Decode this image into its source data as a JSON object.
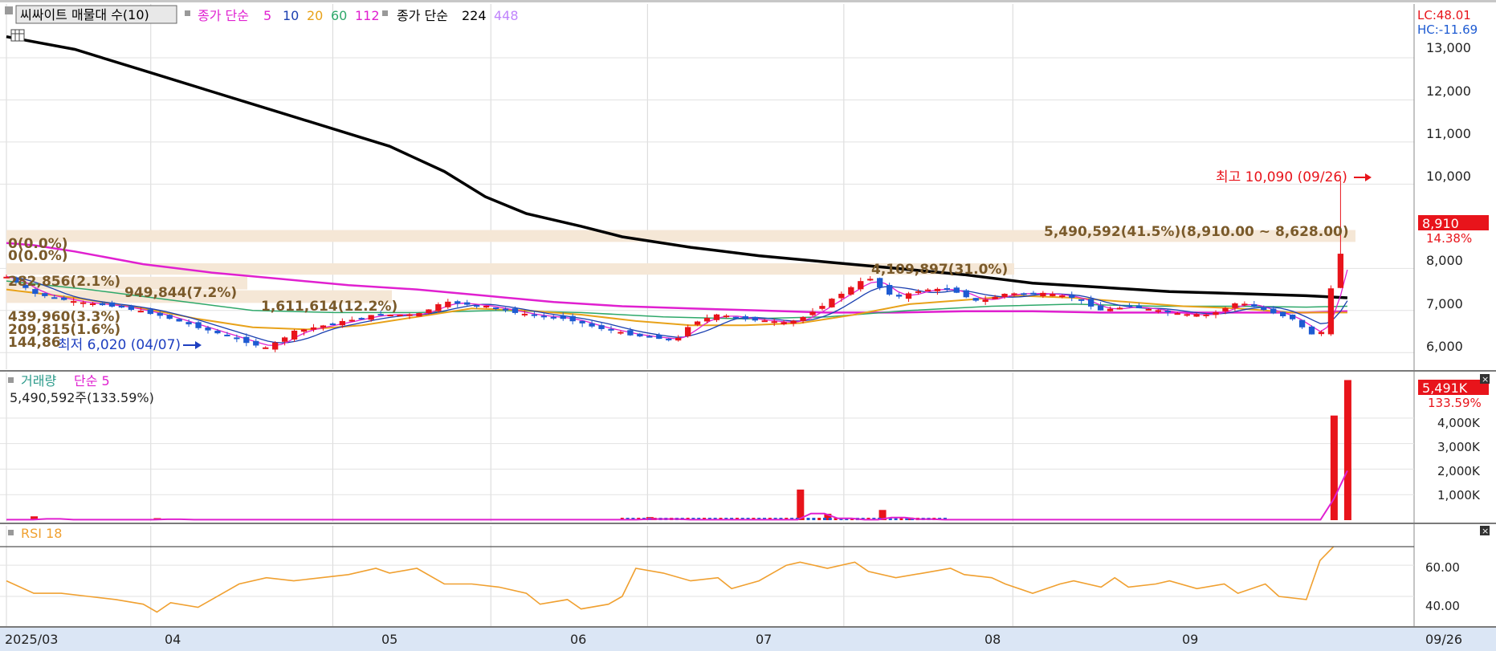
{
  "header": {
    "indicator_label": "씨싸이트 매물대 수(10)",
    "ma_label": "종가 단순",
    "ma_periods": [
      "5",
      "10",
      "20",
      "60",
      "112"
    ],
    "ma2_label": "종가 단순",
    "ma2_periods": [
      "224",
      "448"
    ]
  },
  "lc_hc": {
    "lc": "LC:48.01",
    "hc": "HC:-11.69"
  },
  "price_panel": {
    "y_ticks": [
      "13,000",
      "12,000",
      "11,000",
      "10,000",
      "8,910",
      "8,000",
      "7,000",
      "6,000"
    ],
    "current_price": "8,910",
    "current_change": "14.38%",
    "high_note": "최고 10,090 (09/26)",
    "low_note": "최저 6,020 (04/07)",
    "volume_profile_labels": [
      "5,490,592(41.5%)(8,910.00 ~ 8,628.00)",
      "4,109,897(31.0%)",
      "1,611,614(12.2%)",
      "949,844(7.2%)",
      "282,856(2.1%)",
      "439,960(3.3%)",
      "209,815(1.6%)",
      "144,86",
      "0(0.0%)",
      "0(0.0%)"
    ]
  },
  "volume_panel": {
    "title": "거래량",
    "ma_label": "단순 5",
    "current_info": "5,490,592주(133.59%)",
    "y_ticks": [
      "4,000K",
      "3,000K",
      "2,000K",
      "1,000K"
    ],
    "current_value": "5,491K",
    "current_pct": "133.59%"
  },
  "rsi_panel": {
    "title": "RSI 18",
    "y_ticks": [
      "60.00",
      "40.00"
    ]
  },
  "x_axis": {
    "labels": [
      "2025/03",
      "04",
      "05",
      "06",
      "07",
      "08",
      "09"
    ],
    "current_date": "09/26"
  },
  "colors": {
    "up": "#e8141b",
    "down": "#1e5bd2",
    "ma5": "#e020d0",
    "ma10": "#1a3fb0",
    "ma20": "#e8a21a",
    "ma60": "#2ea86a",
    "ma112": "#e020d0",
    "ma224": "#000000",
    "rsi": "#f0a030",
    "profile_band": "#f5e7d6",
    "profile_text": "#7a5a2a"
  },
  "chart_data": {
    "type": "candlestick",
    "x_range": [
      "2025/03",
      "2025/09/26"
    ],
    "price_ylim": [
      5700,
      13800
    ],
    "volume_ylim": [
      0,
      5600
    ],
    "rsi_ylim": [
      22,
      75
    ],
    "price_anchors": [
      [
        0,
        7800
      ],
      [
        0.02,
        7400
      ],
      [
        0.05,
        7200
      ],
      [
        0.08,
        7100
      ],
      [
        0.11,
        6900
      ],
      [
        0.14,
        6600
      ],
      [
        0.17,
        6300
      ],
      [
        0.19,
        6100
      ],
      [
        0.21,
        6500
      ],
      [
        0.24,
        6700
      ],
      [
        0.27,
        6900
      ],
      [
        0.3,
        6900
      ],
      [
        0.32,
        7200
      ],
      [
        0.35,
        7100
      ],
      [
        0.38,
        6900
      ],
      [
        0.41,
        6800
      ],
      [
        0.43,
        6600
      ],
      [
        0.46,
        6400
      ],
      [
        0.49,
        6300
      ],
      [
        0.5,
        6700
      ],
      [
        0.52,
        6900
      ],
      [
        0.54,
        6800
      ],
      [
        0.57,
        6700
      ],
      [
        0.58,
        6800
      ],
      [
        0.6,
        7200
      ],
      [
        0.62,
        7600
      ],
      [
        0.63,
        7800
      ],
      [
        0.64,
        7500
      ],
      [
        0.65,
        7300
      ],
      [
        0.67,
        7500
      ],
      [
        0.69,
        7500
      ],
      [
        0.71,
        7200
      ],
      [
        0.73,
        7400
      ],
      [
        0.76,
        7400
      ],
      [
        0.78,
        7300
      ],
      [
        0.8,
        7000
      ],
      [
        0.82,
        7100
      ],
      [
        0.84,
        7000
      ],
      [
        0.86,
        6900
      ],
      [
        0.88,
        6900
      ],
      [
        0.9,
        7200
      ],
      [
        0.92,
        7000
      ],
      [
        0.94,
        6800
      ],
      [
        0.95,
        6500
      ],
      [
        0.96,
        6350
      ],
      [
        0.97,
        7800
      ],
      [
        0.98,
        8910
      ]
    ],
    "ma224": [
      [
        0,
        13500
      ],
      [
        0.05,
        13200
      ],
      [
        0.1,
        12700
      ],
      [
        0.15,
        12200
      ],
      [
        0.2,
        11700
      ],
      [
        0.25,
        11200
      ],
      [
        0.28,
        10900
      ],
      [
        0.32,
        10300
      ],
      [
        0.35,
        9700
      ],
      [
        0.38,
        9300
      ],
      [
        0.42,
        9000
      ],
      [
        0.45,
        8750
      ],
      [
        0.5,
        8500
      ],
      [
        0.55,
        8300
      ],
      [
        0.6,
        8150
      ],
      [
        0.65,
        8000
      ],
      [
        0.7,
        7850
      ],
      [
        0.75,
        7650
      ],
      [
        0.8,
        7550
      ],
      [
        0.85,
        7450
      ],
      [
        0.9,
        7400
      ],
      [
        0.95,
        7350
      ],
      [
        0.98,
        7300
      ]
    ],
    "ma112": [
      [
        0,
        8600
      ],
      [
        0.02,
        8550
      ],
      [
        0.05,
        8400
      ],
      [
        0.1,
        8100
      ],
      [
        0.15,
        7900
      ],
      [
        0.2,
        7750
      ],
      [
        0.25,
        7600
      ],
      [
        0.3,
        7500
      ],
      [
        0.35,
        7350
      ],
      [
        0.4,
        7200
      ],
      [
        0.45,
        7100
      ],
      [
        0.5,
        7050
      ],
      [
        0.55,
        7000
      ],
      [
        0.6,
        6950
      ],
      [
        0.65,
        6950
      ],
      [
        0.7,
        6980
      ],
      [
        0.75,
        6980
      ],
      [
        0.8,
        6950
      ],
      [
        0.85,
        6950
      ],
      [
        0.9,
        6950
      ],
      [
        0.95,
        6950
      ],
      [
        0.98,
        6980
      ]
    ],
    "ma20": [
      [
        0,
        7500
      ],
      [
        0.05,
        7300
      ],
      [
        0.1,
        7050
      ],
      [
        0.14,
        6800
      ],
      [
        0.18,
        6600
      ],
      [
        0.22,
        6550
      ],
      [
        0.26,
        6650
      ],
      [
        0.3,
        6850
      ],
      [
        0.34,
        7050
      ],
      [
        0.38,
        7000
      ],
      [
        0.42,
        6900
      ],
      [
        0.46,
        6750
      ],
      [
        0.5,
        6650
      ],
      [
        0.54,
        6650
      ],
      [
        0.58,
        6700
      ],
      [
        0.62,
        6900
      ],
      [
        0.66,
        7150
      ],
      [
        0.7,
        7250
      ],
      [
        0.74,
        7350
      ],
      [
        0.78,
        7300
      ],
      [
        0.82,
        7200
      ],
      [
        0.86,
        7100
      ],
      [
        0.9,
        7050
      ],
      [
        0.94,
        6950
      ],
      [
        0.98,
        6950
      ]
    ],
    "ma60": [
      [
        0,
        7700
      ],
      [
        0.06,
        7500
      ],
      [
        0.12,
        7250
      ],
      [
        0.18,
        7000
      ],
      [
        0.24,
        6950
      ],
      [
        0.3,
        6950
      ],
      [
        0.36,
        7000
      ],
      [
        0.42,
        6950
      ],
      [
        0.48,
        6850
      ],
      [
        0.54,
        6800
      ],
      [
        0.6,
        6850
      ],
      [
        0.66,
        7000
      ],
      [
        0.72,
        7100
      ],
      [
        0.78,
        7150
      ],
      [
        0.84,
        7100
      ],
      [
        0.9,
        7100
      ],
      [
        0.95,
        7080
      ],
      [
        0.98,
        7100
      ]
    ],
    "volume_spikes": [
      [
        0.02,
        150
      ],
      [
        0.11,
        80
      ],
      [
        0.47,
        120
      ],
      [
        0.58,
        1200
      ],
      [
        0.6,
        250
      ],
      [
        0.64,
        400
      ],
      [
        0.66,
        100
      ],
      [
        0.97,
        4100
      ],
      [
        0.98,
        5491
      ]
    ],
    "rsi": [
      [
        0,
        50
      ],
      [
        0.02,
        42
      ],
      [
        0.04,
        42
      ],
      [
        0.06,
        40
      ],
      [
        0.08,
        38
      ],
      [
        0.1,
        35
      ],
      [
        0.11,
        30
      ],
      [
        0.12,
        36
      ],
      [
        0.14,
        33
      ],
      [
        0.15,
        38
      ],
      [
        0.17,
        48
      ],
      [
        0.19,
        52
      ],
      [
        0.21,
        50
      ],
      [
        0.23,
        52
      ],
      [
        0.25,
        54
      ],
      [
        0.27,
        58
      ],
      [
        0.28,
        55
      ],
      [
        0.3,
        58
      ],
      [
        0.32,
        48
      ],
      [
        0.34,
        48
      ],
      [
        0.36,
        46
      ],
      [
        0.38,
        42
      ],
      [
        0.39,
        35
      ],
      [
        0.41,
        38
      ],
      [
        0.42,
        32
      ],
      [
        0.44,
        35
      ],
      [
        0.45,
        40
      ],
      [
        0.46,
        58
      ],
      [
        0.48,
        55
      ],
      [
        0.5,
        50
      ],
      [
        0.52,
        52
      ],
      [
        0.53,
        45
      ],
      [
        0.55,
        50
      ],
      [
        0.57,
        60
      ],
      [
        0.58,
        62
      ],
      [
        0.6,
        58
      ],
      [
        0.62,
        62
      ],
      [
        0.63,
        56
      ],
      [
        0.65,
        52
      ],
      [
        0.67,
        55
      ],
      [
        0.69,
        58
      ],
      [
        0.7,
        54
      ],
      [
        0.72,
        52
      ],
      [
        0.73,
        48
      ],
      [
        0.75,
        42
      ],
      [
        0.77,
        48
      ],
      [
        0.78,
        50
      ],
      [
        0.8,
        46
      ],
      [
        0.81,
        52
      ],
      [
        0.82,
        46
      ],
      [
        0.84,
        48
      ],
      [
        0.85,
        50
      ],
      [
        0.87,
        45
      ],
      [
        0.89,
        48
      ],
      [
        0.9,
        42
      ],
      [
        0.92,
        48
      ],
      [
        0.93,
        40
      ],
      [
        0.95,
        38
      ],
      [
        0.96,
        63
      ],
      [
        0.97,
        72
      ]
    ]
  }
}
